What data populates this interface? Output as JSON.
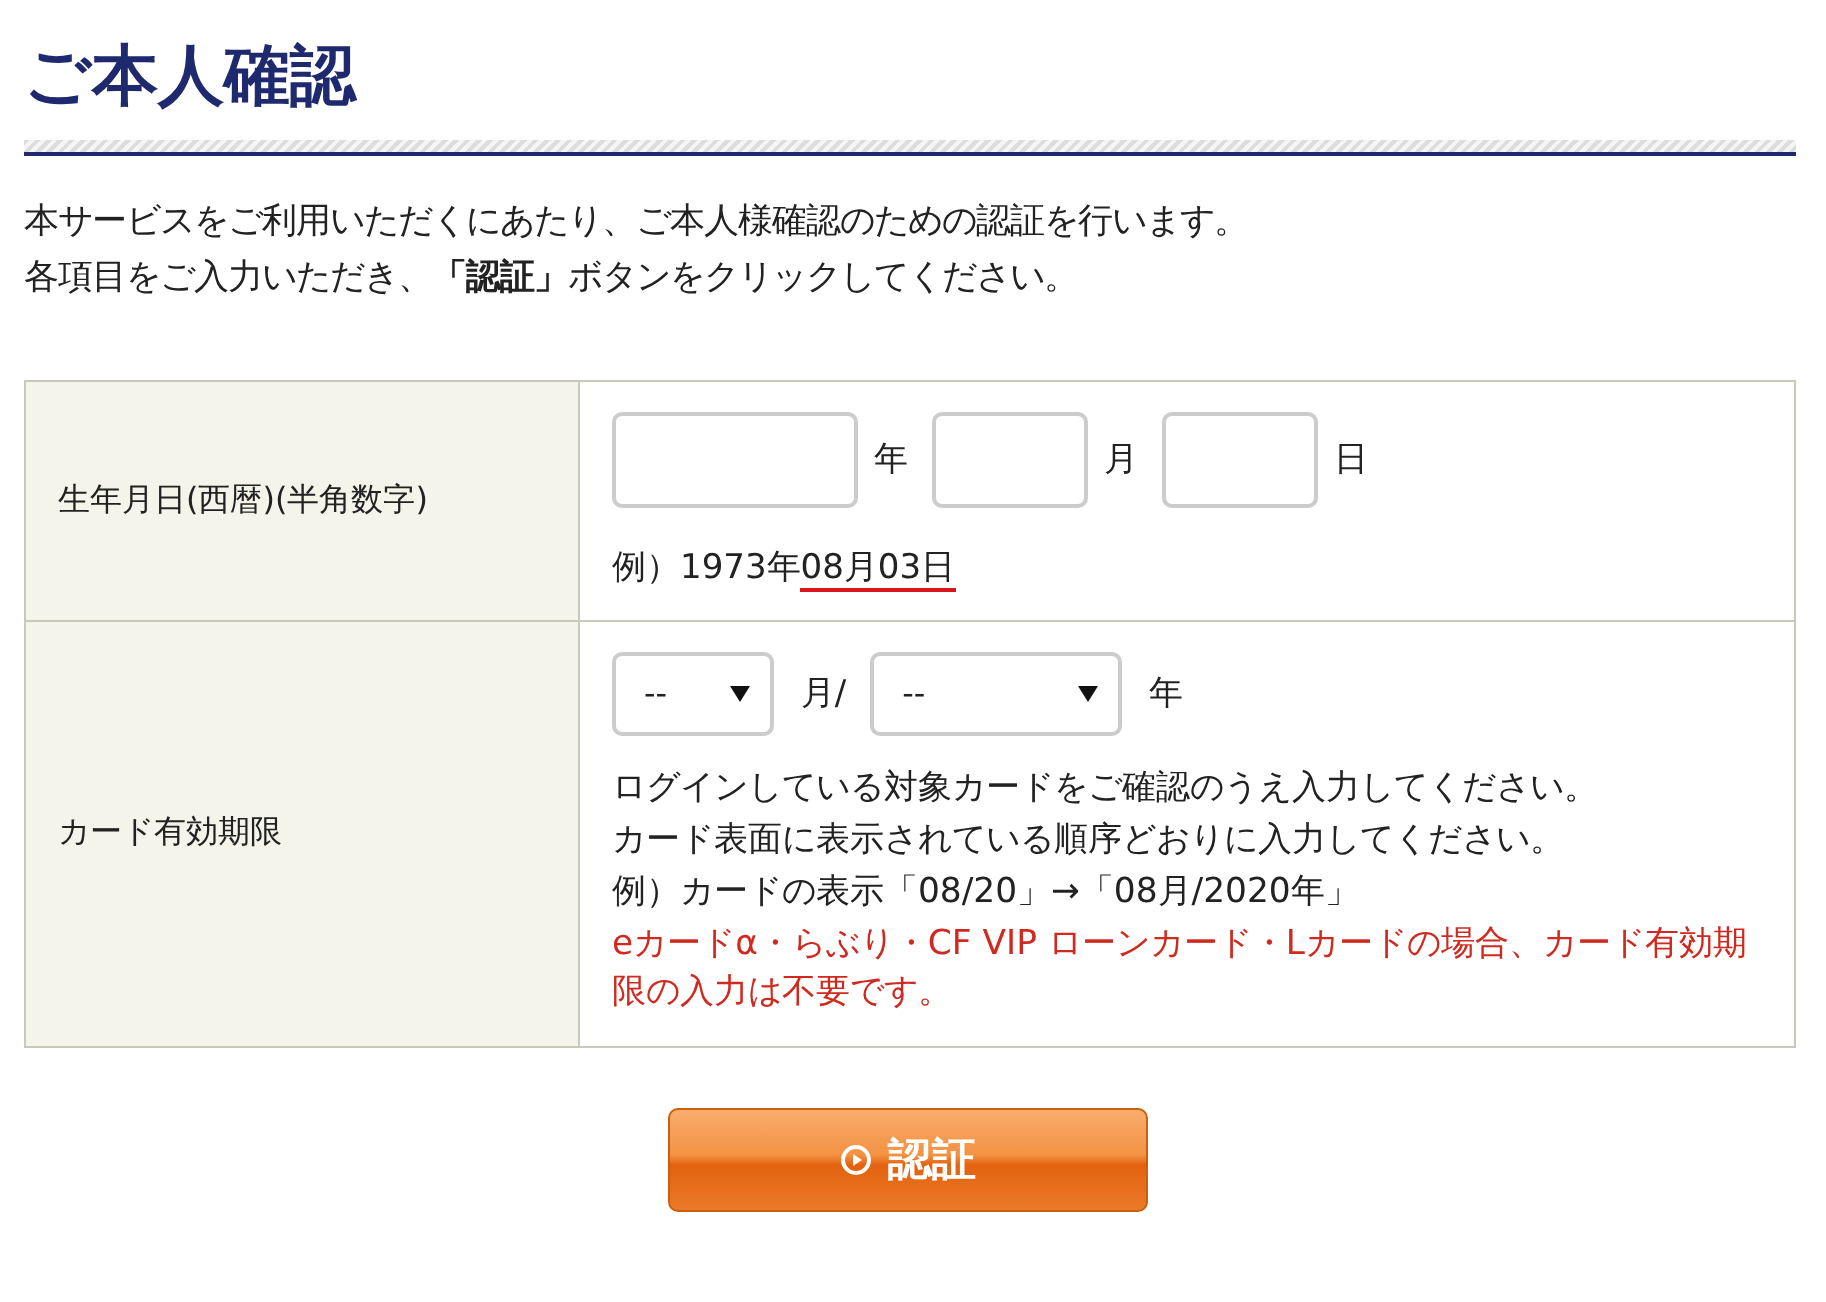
{
  "title": "ご本人確認",
  "intro": [
    "本サービスをご利用いただくにあたり、ご本人様確認のための認証を行います。",
    "各項目をご入力いただき、**「認証」**ボタンをクリックしてください。"
  ],
  "rows": [
    {
      "kind": "date",
      "label": "生年月日(西暦)(半角数字)",
      "fields": [
        {
          "unit": "年"
        },
        {
          "unit": "月"
        },
        {
          "unit": "日"
        }
      ],
      "example": {
        "prefix": "例）1973年",
        "highlight": "08月03日"
      }
    },
    {
      "kind": "expiry",
      "label": "カード有効期限",
      "selects": [
        {
          "value": "--",
          "unit": "月/"
        },
        {
          "value": "--",
          "unit": "年"
        }
      ],
      "notes": [
        "ログインしている対象カードをご確認のうえ入力してください。",
        "カード表面に表示されている順序どおりに入力してください。",
        "例）カードの表示「08/20」→「08月/2020年」"
      ],
      "warning": "eカードα・らぶり・CF VIP ローンカード・Lカードの場合、カード有効期限の入力は不要です。"
    }
  ],
  "submit": {
    "label": "認証"
  }
}
